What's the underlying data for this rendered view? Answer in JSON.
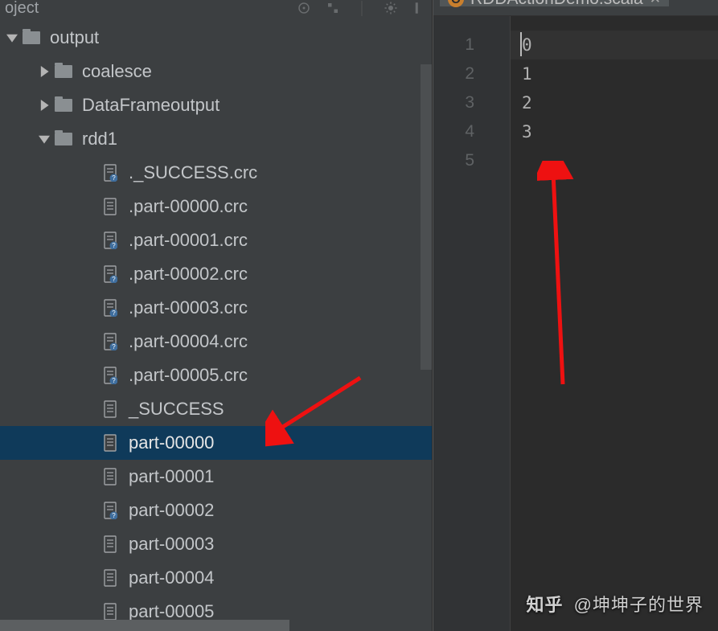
{
  "sidebar": {
    "title": "oject",
    "tree": {
      "root": {
        "label": "output"
      },
      "children": [
        {
          "label": "coalesce",
          "expanded": false
        },
        {
          "label": "DataFrameoutput",
          "expanded": false
        },
        {
          "label": "rdd1",
          "expanded": true
        }
      ],
      "rdd1_files": [
        {
          "label": "._SUCCESS.crc",
          "kind": "unknown"
        },
        {
          "label": ".part-00000.crc",
          "kind": "text"
        },
        {
          "label": ".part-00001.crc",
          "kind": "unknown"
        },
        {
          "label": ".part-00002.crc",
          "kind": "unknown"
        },
        {
          "label": ".part-00003.crc",
          "kind": "unknown"
        },
        {
          "label": ".part-00004.crc",
          "kind": "unknown"
        },
        {
          "label": ".part-00005.crc",
          "kind": "unknown"
        },
        {
          "label": "_SUCCESS",
          "kind": "text"
        },
        {
          "label": "part-00000",
          "kind": "text",
          "selected": true
        },
        {
          "label": "part-00001",
          "kind": "text"
        },
        {
          "label": "part-00002",
          "kind": "unknown"
        },
        {
          "label": "part-00003",
          "kind": "text"
        },
        {
          "label": "part-00004",
          "kind": "text"
        },
        {
          "label": "part-00005",
          "kind": "text"
        }
      ]
    }
  },
  "editor": {
    "tab": {
      "badge": "O",
      "title": "RDDActionDemo.scala"
    },
    "line_numbers": [
      "1",
      "2",
      "3",
      "4",
      "5"
    ],
    "code_lines": [
      "0",
      "1",
      "2",
      "3",
      ""
    ]
  },
  "watermark": {
    "brand": "知乎",
    "author": "@坤坤子的世界"
  }
}
